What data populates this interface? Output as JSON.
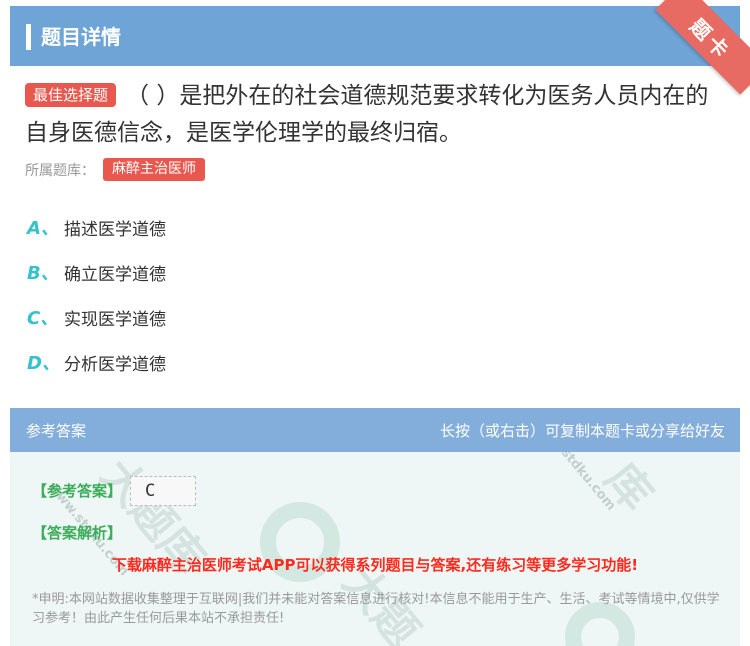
{
  "header": {
    "title": "题目详情"
  },
  "corner": {
    "label": "题卡"
  },
  "question": {
    "badge": "最佳选择题",
    "text": "（ ）是把外在的社会道德规范要求转化为医务人员内在的自身医德信念，是医学伦理学的最终归宿。"
  },
  "library": {
    "label": "所属题库：",
    "name": "麻醉主治医师"
  },
  "options": [
    {
      "letter": "A、",
      "text": "描述医学道德"
    },
    {
      "letter": "B、",
      "text": "确立医学道德"
    },
    {
      "letter": "C、",
      "text": "实现医学道德"
    },
    {
      "letter": "D、",
      "text": "分析医学道德"
    }
  ],
  "answer_section": {
    "title": "参考答案",
    "hint": "长按（或右击）可复制本题卡或分享给好友",
    "ref_label": "【参考答案】",
    "ref_value": "C",
    "analysis_label": "【答案解析】",
    "promo": "下载麻醉主治医师考试APP可以获得系列题目与答案,还有练习等更多学习功能!",
    "disclaimer": "*申明:本网站数据收集整理于互联网|我们并未能对答案信息进行核对!本信息不能用于生产、生活、考试等情境中,仅供学习参考！由此产生任何后果本站不承担责任!"
  },
  "colors": {
    "header": "#6fa4d7",
    "accent_red": "#e8584f",
    "option_letter": "#36c1cc",
    "answer_green": "#3cad5a"
  }
}
